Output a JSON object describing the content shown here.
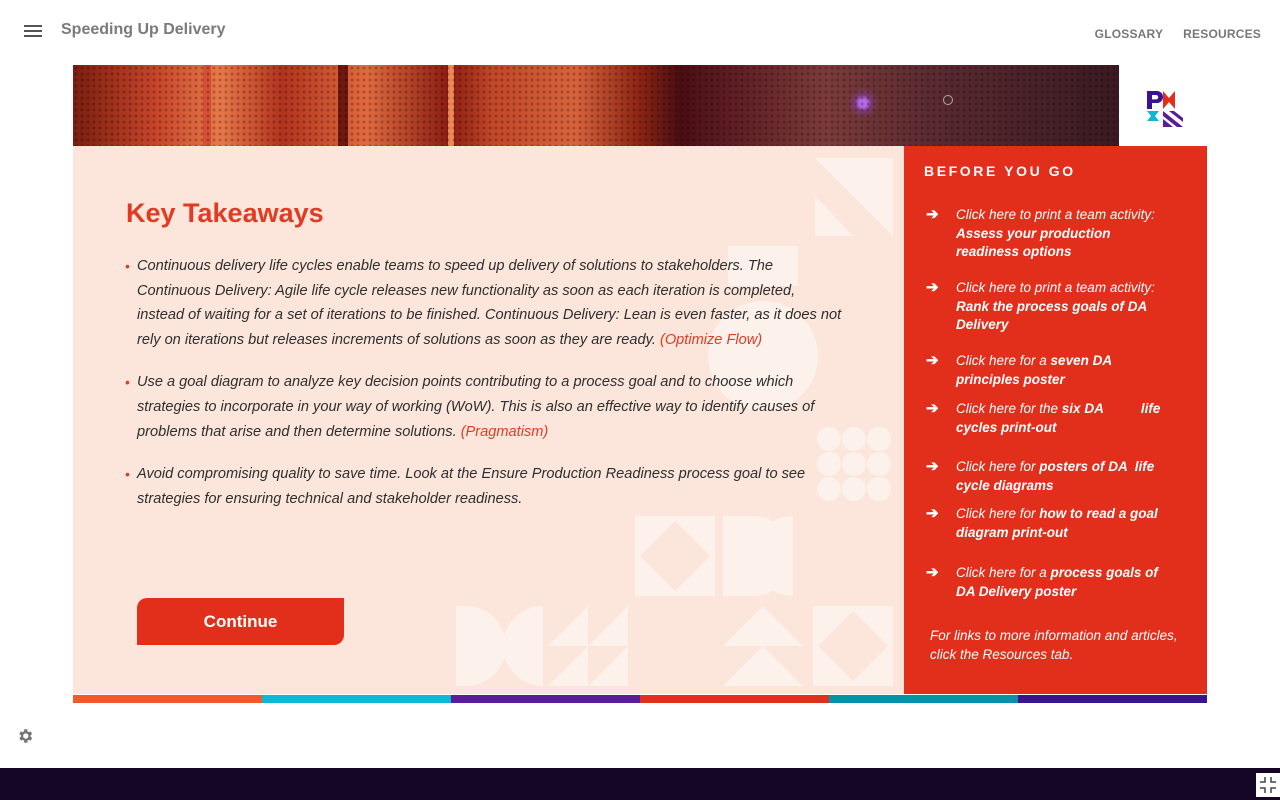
{
  "header": {
    "title": "Speeding Up Delivery",
    "menu_icon": "hamburger-menu-icon",
    "nav": [
      "GLOSSARY",
      "RESOURCES"
    ]
  },
  "main": {
    "heading": "Key Takeaways",
    "bullets": [
      {
        "text": "Continuous delivery life cycles enable teams to speed up delivery of solutions to stakeholders. The Continuous Delivery: Agile life cycle releases new functionality as soon as each iteration is completed, instead of waiting for a set of iterations to be finished. Continuous Delivery: Lean is even faster, as it does not rely on iterations but releases increments of solutions as soon as they are ready. ",
        "link": "(Optimize Flow)"
      },
      {
        "text": "Use a goal diagram to analyze key decision points contributing to a process goal and to choose which strategies to incorporate in your way of working (WoW). This is also an effective way to identify causes of problems that arise and then determine solutions. ",
        "link": "(Pragmatism)"
      },
      {
        "text": "Avoid compromising quality to save time. Look at the Ensure Production Readiness process goal to see strategies for ensuring technical and stakeholder readiness.",
        "link": ""
      }
    ],
    "continue_label": "Continue"
  },
  "sidebar": {
    "title": "BEFORE YOU GO",
    "arrow_icon": "arrow-right-icon",
    "items": [
      {
        "prefix": "Click here to print a team activity: ",
        "bold": "Assess your production readiness options"
      },
      {
        "prefix": "Click here to print a team activity: ",
        "bold": "Rank the process goals of DA Delivery"
      },
      {
        "prefix": "Click here for a ",
        "bold": "seven DA principles poster"
      },
      {
        "prefix": "Click here for the ",
        "bold": "six DA          life cycles print-out"
      },
      {
        "prefix": "Click here for ",
        "bold": "posters of DA  life cycle diagrams"
      },
      {
        "prefix": "Click here for ",
        "bold": "how to read a goal diagram print-out"
      },
      {
        "prefix": "Click here for a ",
        "bold": "process goals of DA Delivery poster"
      }
    ],
    "footer": "For links to more information and articles, click the Resources tab."
  },
  "brand": {
    "logo": "pmi-logo",
    "stripe_colors": [
      "#f05a28",
      "#10b6d6",
      "#5b1c9c",
      "#e22f1b",
      "#0a8fa8",
      "#3a1490"
    ],
    "accent": "#e22f1b",
    "panel_bg": "#fce6dc",
    "footer_bg": "#140624"
  },
  "footer": {
    "settings_icon": "gear-icon",
    "collapse_icon": "collapse-fullscreen-icon"
  }
}
